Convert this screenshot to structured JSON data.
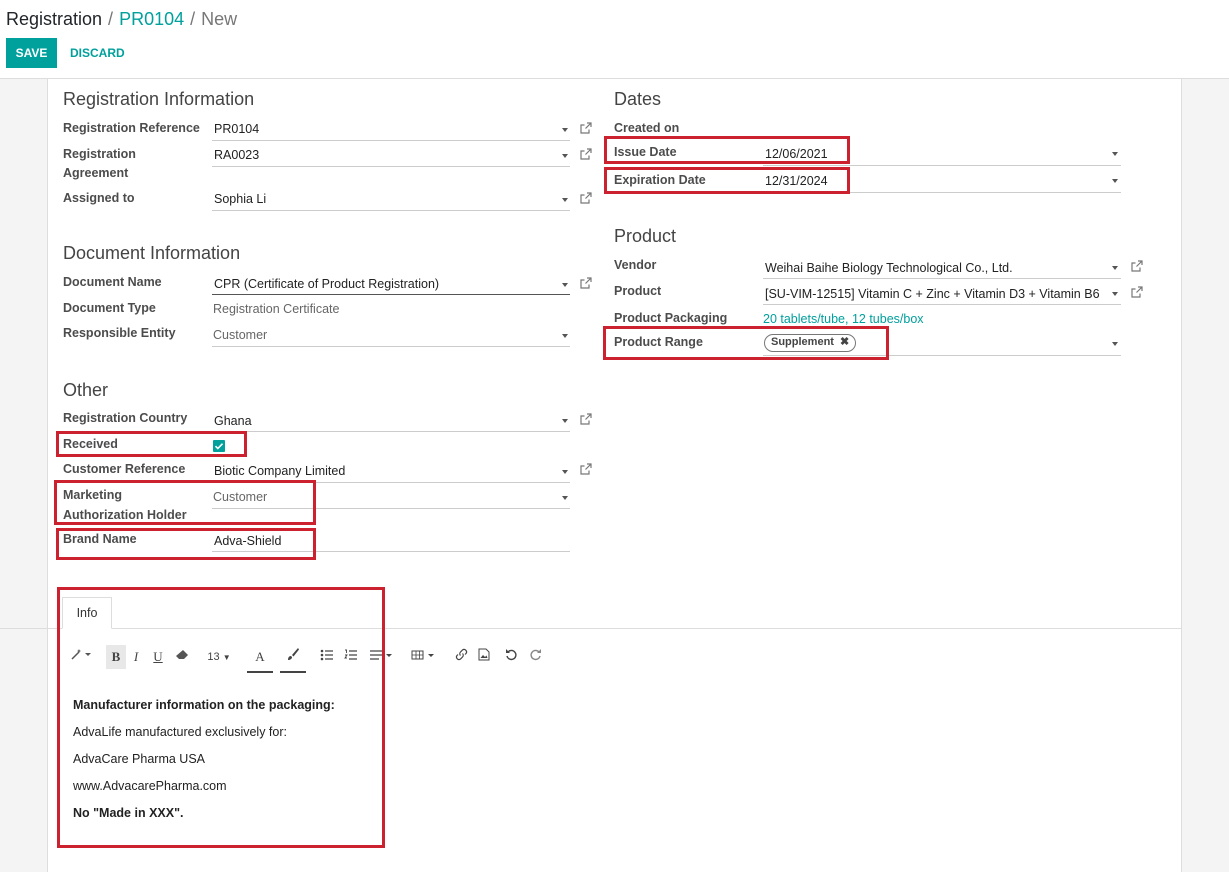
{
  "breadcrumb": {
    "root": "Registration",
    "record": "PR0104",
    "current": "New"
  },
  "buttons": {
    "save": "SAVE",
    "discard": "DISCARD"
  },
  "registration_info": {
    "title": "Registration Information",
    "reference_label": "Registration Reference",
    "reference_value": "PR0104",
    "agreement_label_1": "Registration",
    "agreement_label_2": "Agreement",
    "agreement_value": "RA0023",
    "assigned_label": "Assigned to",
    "assigned_value": "Sophia Li"
  },
  "document_info": {
    "title": "Document Information",
    "name_label": "Document Name",
    "name_value": "CPR (Certificate of Product Registration)",
    "type_label": "Document Type",
    "type_value": "Registration Certificate",
    "entity_label": "Responsible Entity",
    "entity_value": "Customer"
  },
  "other": {
    "title": "Other",
    "country_label": "Registration Country",
    "country_value": "Ghana",
    "received_label": "Received",
    "received_checked": true,
    "customer_ref_label": "Customer Reference",
    "customer_ref_value": "Biotic Company Limited",
    "mah_label_1": "Marketing",
    "mah_label_2": "Authorization Holder",
    "mah_value": "Customer",
    "brand_label": "Brand Name",
    "brand_value": "Adva-Shield"
  },
  "dates": {
    "title": "Dates",
    "created_label": "Created on",
    "issue_label": "Issue Date",
    "issue_value": "12/06/2021",
    "expiration_label": "Expiration Date",
    "expiration_value": "12/31/2024"
  },
  "product": {
    "title": "Product",
    "vendor_label": "Vendor",
    "vendor_value": "Weihai Baihe Biology Technological Co., Ltd.",
    "product_label": "Product",
    "product_value": "[SU-VIM-12515] Vitamin C + Zinc + Vitamin D3 + Vitamin B6",
    "packaging_label": "Product Packaging",
    "packaging_value": "20 tablets/tube, 12 tubes/box",
    "range_label": "Product Range",
    "range_tag": "Supplement"
  },
  "tabs": {
    "info": "Info"
  },
  "editor": {
    "font_size": "13",
    "lines": [
      "Manufacturer information on the packaging:",
      "AdvaLife manufactured exclusively for:",
      "AdvaCare Pharma USA",
      "www.AdvacarePharma.com",
      "No \"Made in XXX\"."
    ]
  },
  "colors": {
    "accent": "#00a09d",
    "highlight": "#cc2230"
  }
}
